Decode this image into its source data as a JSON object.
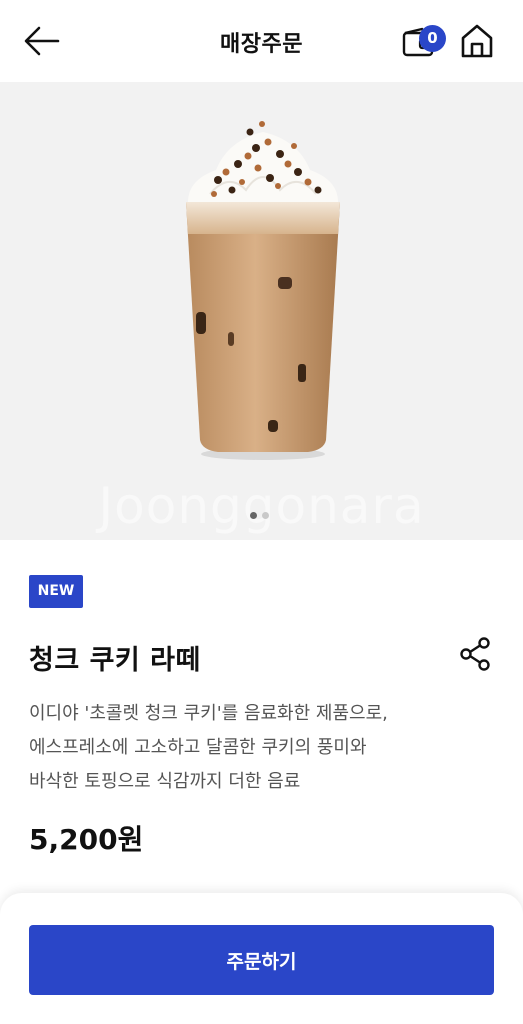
{
  "header": {
    "title": "매장주문",
    "cart_count": "0",
    "icons": {
      "back": "back-arrow-icon",
      "cart": "cart-icon",
      "home": "home-icon"
    }
  },
  "hero": {
    "watermark": "Joonggonara",
    "slide_count": 2,
    "active_slide": 1
  },
  "product": {
    "badge": "NEW",
    "name": "청크 쿠키 라떼",
    "description_lines": [
      "이디야 '초콜렛 청크 쿠키'를 음료화한 제품으로,",
      "에스프레소에 고소하고 달콤한 쿠키의 풍미와",
      "바삭한 토핑으로 식감까지 더한 음료"
    ],
    "price": "5,200원"
  },
  "bottom": {
    "order_label": "주문하기"
  },
  "colors": {
    "accent": "#2a46c8",
    "hero_bg": "#f2f2f2",
    "text": "#111111",
    "muted": "#555555"
  }
}
